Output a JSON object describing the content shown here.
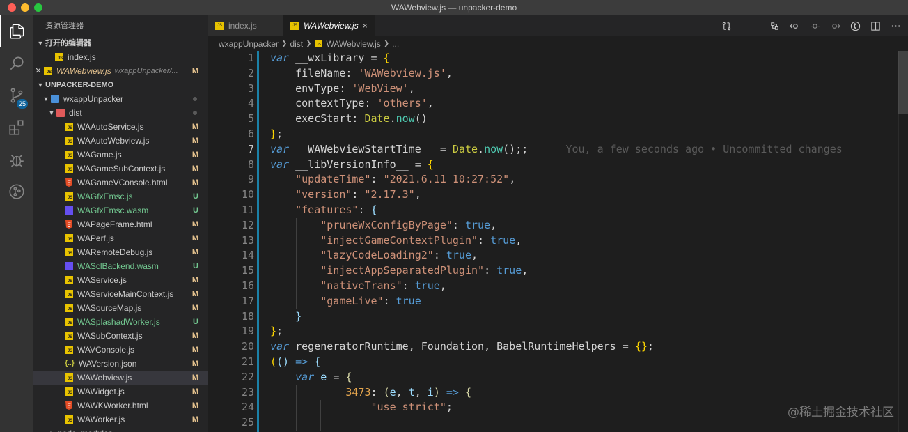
{
  "window": {
    "title": "WAWebview.js — unpacker-demo"
  },
  "activity": {
    "scm_badge": "25"
  },
  "sidebar": {
    "title": "资源管理器",
    "open_editors_header": "打开的编辑器",
    "open_editors": [
      {
        "name": "index.js"
      },
      {
        "name": "WAWebview.js",
        "path": "wxappUnpacker/...",
        "status": "M"
      }
    ],
    "project_header": "UNPACKER-DEMO",
    "root_folder": "wxappUnpacker",
    "dist_folder": "dist",
    "files": [
      {
        "name": "WAAutoService.js",
        "type": "js",
        "status": "M"
      },
      {
        "name": "WAAutoWebview.js",
        "type": "js",
        "status": "M"
      },
      {
        "name": "WAGame.js",
        "type": "js",
        "status": "M"
      },
      {
        "name": "WAGameSubContext.js",
        "type": "js",
        "status": "M"
      },
      {
        "name": "WAGameVConsole.html",
        "type": "html",
        "status": "M"
      },
      {
        "name": "WAGfxEmsc.js",
        "type": "js",
        "status": "U"
      },
      {
        "name": "WAGfxEmsc.wasm",
        "type": "wasm",
        "status": "U"
      },
      {
        "name": "WAPageFrame.html",
        "type": "html",
        "status": "M"
      },
      {
        "name": "WAPerf.js",
        "type": "js",
        "status": "M"
      },
      {
        "name": "WARemoteDebug.js",
        "type": "js",
        "status": "M"
      },
      {
        "name": "WASclBackend.wasm",
        "type": "wasm",
        "status": "U"
      },
      {
        "name": "WAService.js",
        "type": "js",
        "status": "M"
      },
      {
        "name": "WAServiceMainContext.js",
        "type": "js",
        "status": "M"
      },
      {
        "name": "WASourceMap.js",
        "type": "js",
        "status": "M"
      },
      {
        "name": "WASplashadWorker.js",
        "type": "js",
        "status": "U"
      },
      {
        "name": "WASubContext.js",
        "type": "js",
        "status": "M"
      },
      {
        "name": "WAVConsole.js",
        "type": "js",
        "status": "M"
      },
      {
        "name": "WAVersion.json",
        "type": "json",
        "status": "M"
      },
      {
        "name": "WAWebview.js",
        "type": "js",
        "status": "M",
        "selected": true
      },
      {
        "name": "WAWidget.js",
        "type": "js",
        "status": "M"
      },
      {
        "name": "WAWKWorker.html",
        "type": "html",
        "status": "M"
      },
      {
        "name": "WAWorker.js",
        "type": "js",
        "status": "M"
      }
    ],
    "node_modules": "node_modules"
  },
  "tabs": [
    {
      "label": "index.js"
    },
    {
      "label": "WAWebview.js",
      "close": "×"
    }
  ],
  "breadcrumb": {
    "parts": [
      "wxappUnpacker",
      "dist",
      "WAWebview.js",
      "..."
    ]
  },
  "editor": {
    "line_numbers": [
      "1",
      "2",
      "3",
      "4",
      "5",
      "6",
      "7",
      "8",
      "9",
      "10",
      "11",
      "12",
      "13",
      "14",
      "15",
      "16",
      "17",
      "18",
      "19",
      "20",
      "21",
      "22",
      "23",
      "24",
      "25"
    ],
    "active_line": 7,
    "blame": "You, a few seconds ago • Uncommitted changes",
    "tokens": {
      "var": "var",
      "wxLibrary": "__wxLibrary",
      "eq": "=",
      "lbrace": "{",
      "rbrace": "}",
      "fileName_key": "fileName",
      "fileName_val": "'WAWebview.js'",
      "envType_key": "envType",
      "envType_val": "'WebView'",
      "contextType_key": "contextType",
      "contextType_val": "'others'",
      "execStart_key": "execStart",
      "Date": "Date",
      "now": "now",
      "startTime": "__WAWebviewStartTime__",
      "libVersionInfo": "__libVersionInfo__",
      "updateTime_key": "\"updateTime\"",
      "updateTime_val": "\"2021.6.11 10:27:52\"",
      "version_key": "\"version\"",
      "version_val": "\"2.17.3\"",
      "features_key": "\"features\"",
      "f1": "\"pruneWxConfigByPage\"",
      "f2": "\"injectGameContextPlugin\"",
      "f3": "\"lazyCodeLoading2\"",
      "f4": "\"injectAppSeparatedPlugin\"",
      "f5": "\"nativeTrans\"",
      "f6": "\"gameLive\"",
      "true": "true",
      "regen": "regeneratorRuntime",
      "foundation": "Foundation",
      "babel": "BabelRuntimeHelpers",
      "arrow": "=>",
      "e": "e",
      "t": "t",
      "i": "i",
      "num3473": "3473",
      "use_strict": "\"use strict\""
    }
  },
  "watermark": "@稀土掘金技术社区"
}
